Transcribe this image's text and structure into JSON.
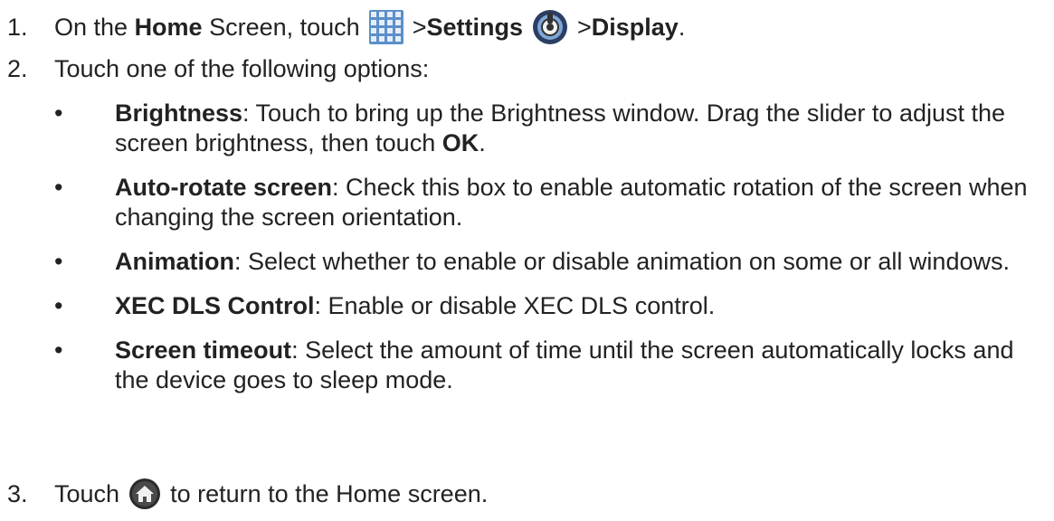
{
  "steps": {
    "s1": {
      "num": "1.",
      "pre": "On the ",
      "home": "Home",
      "screen_touch": " Screen, touch",
      "gt1": "> ",
      "settings": "Settings",
      "gt2": "> ",
      "display": "Display",
      "period": "."
    },
    "s2": {
      "num": "2.",
      "text": "Touch one of the following options:"
    },
    "s3": {
      "num": "3.",
      "pre": "Touch",
      "post": "to return to the Home screen."
    }
  },
  "options": [
    {
      "title": "Brightness",
      "text_a": ": Touch to bring up the Brightness window. Drag the slider to adjust the screen brightness, then touch ",
      "ok": "OK",
      "text_b": "."
    },
    {
      "title": "Auto-rotate screen",
      "text_a": ": Check this box to enable automatic rotation of the screen when changing the screen orientation."
    },
    {
      "title": "Animation",
      "text_a": ": Select whether to enable or disable animation on some or all windows."
    },
    {
      "title": "XEC DLS Control",
      "text_a": ": Enable or disable XEC DLS control."
    },
    {
      "title": "Screen timeout",
      "text_a": ": Select the amount of time until the screen automatically locks and the device goes to sleep mode."
    }
  ],
  "bullet_char": "•",
  "icons": {
    "apps": "apps-grid-icon",
    "settings": "settings-icon",
    "home": "home-icon"
  }
}
